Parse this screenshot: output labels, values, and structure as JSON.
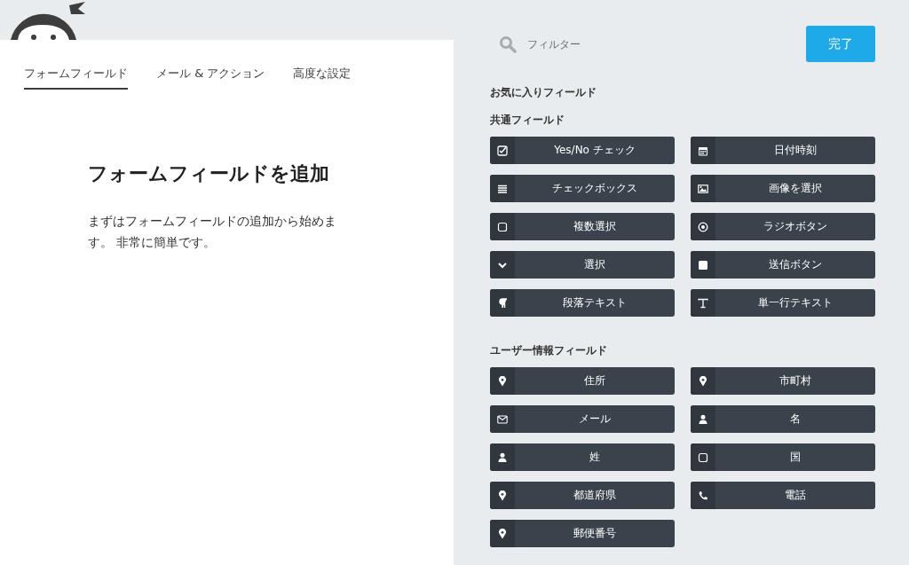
{
  "tabs": [
    {
      "label": "フォームフィールド",
      "selected": true
    },
    {
      "label": "メール & アクション",
      "selected": false
    },
    {
      "label": "高度な設定",
      "selected": false
    }
  ],
  "intro": {
    "title": "フォームフィールドを追加",
    "text": "まずはフォームフィールドの追加から始めます。 非常に簡単です。"
  },
  "search": {
    "placeholder": "フィルター"
  },
  "done_button": "完了",
  "sections": [
    {
      "title": "お気に入りフィールド"
    },
    {
      "title": "共通フィールド",
      "fields": [
        {
          "label": "Yes/No チェック",
          "kind": "checkbox"
        },
        {
          "label": "日付時刻",
          "kind": "calendar"
        },
        {
          "label": "チェックボックス",
          "kind": "list"
        },
        {
          "label": "画像を選択",
          "kind": "image"
        },
        {
          "label": "複数選択",
          "kind": "square"
        },
        {
          "label": "ラジオボタン",
          "kind": "radio"
        },
        {
          "label": "選択",
          "kind": "chevron"
        },
        {
          "label": "送信ボタン",
          "kind": "button"
        },
        {
          "label": "段落テキスト",
          "kind": "paragraph"
        },
        {
          "label": "単一行テキスト",
          "kind": "text"
        }
      ]
    },
    {
      "title": "ユーザー情報フィールド",
      "fields": [
        {
          "label": "住所",
          "kind": "location"
        },
        {
          "label": "市町村",
          "kind": "location"
        },
        {
          "label": "メール",
          "kind": "email"
        },
        {
          "label": "名",
          "kind": "user"
        },
        {
          "label": "姓",
          "kind": "user"
        },
        {
          "label": "国",
          "kind": "square"
        },
        {
          "label": "都道府県",
          "kind": "location"
        },
        {
          "label": "電話",
          "kind": "phone"
        },
        {
          "label": "郵便番号",
          "kind": "location"
        }
      ]
    }
  ]
}
